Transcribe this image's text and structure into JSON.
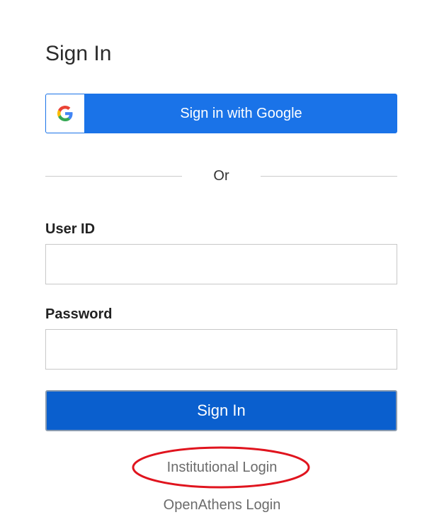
{
  "page": {
    "title": "Sign In"
  },
  "google": {
    "label": "Sign in with Google",
    "icon": "google-g-icon"
  },
  "divider": {
    "text": "Or"
  },
  "form": {
    "user_id": {
      "label": "User ID",
      "value": "",
      "placeholder": ""
    },
    "password": {
      "label": "Password",
      "value": "",
      "placeholder": ""
    },
    "submit_label": "Sign In"
  },
  "links": {
    "institutional": "Institutional Login",
    "openathens": "OpenAthens Login"
  },
  "colors": {
    "google_blue": "#1a73e8",
    "primary_button": "#0a5fce",
    "link_gray": "#6b6b6b",
    "annotation_red": "#e0141e"
  }
}
